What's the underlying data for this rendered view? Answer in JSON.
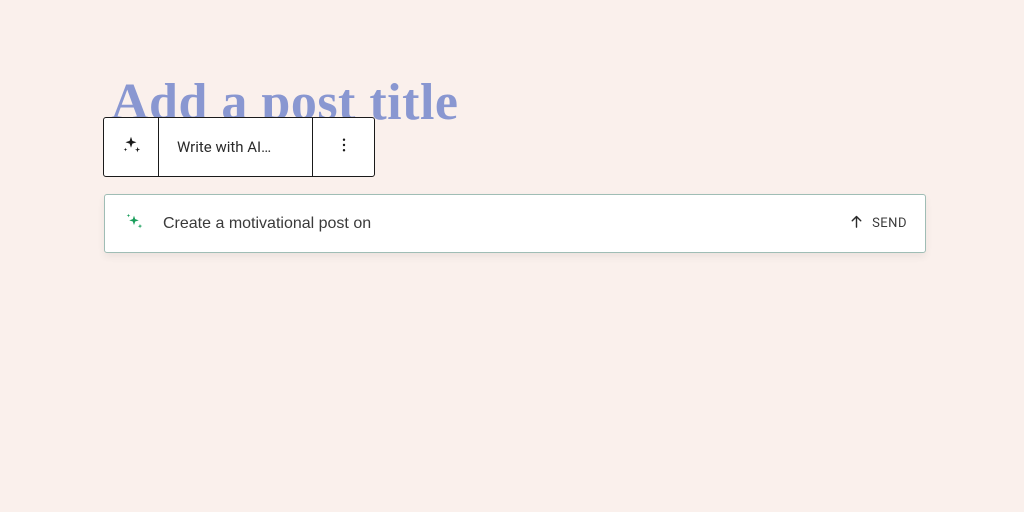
{
  "title": {
    "placeholder": "Add a post title"
  },
  "toolbar": {
    "write_label": "Write with AI…"
  },
  "input": {
    "value": "Create a motivational post on",
    "send_label": "SEND"
  },
  "icons": {
    "sparkle_black": "sparkle",
    "sparkle_green": "sparkle",
    "more_vertical": "more",
    "arrow_up": "arrow"
  },
  "colors": {
    "bg": "#faf0ec",
    "title": "#8997d1",
    "accent_green": "#1a9e5c",
    "border_dark": "#1a1a1a",
    "border_input": "#9fbdb5"
  }
}
